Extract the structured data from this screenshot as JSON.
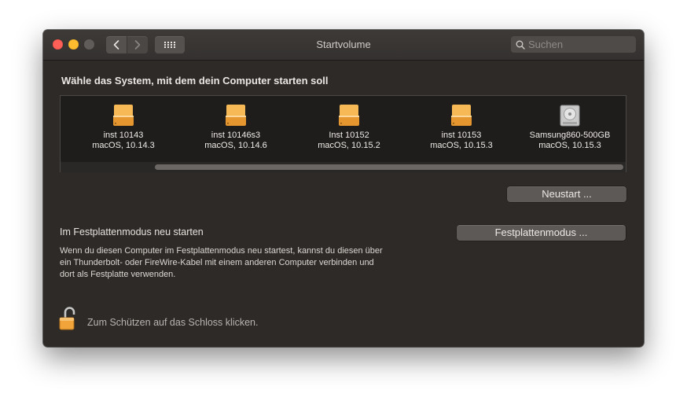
{
  "window": {
    "title": "Startvolume"
  },
  "search": {
    "placeholder": "Suchen"
  },
  "heading": "Wähle das System, mit dem dein Computer starten soll",
  "disks": [
    {
      "name": "inst 10143",
      "os": "macOS, 10.14.3",
      "icon": "external-orange-disk-icon"
    },
    {
      "name": "inst 10146s3",
      "os": "macOS, 10.14.6",
      "icon": "external-orange-disk-icon"
    },
    {
      "name": "Inst 10152",
      "os": "macOS, 10.15.2",
      "icon": "external-orange-disk-icon"
    },
    {
      "name": "inst 10153",
      "os": "macOS, 10.15.3",
      "icon": "external-orange-disk-icon"
    },
    {
      "name": "Samsung860-500GB",
      "os": "macOS, 10.15.3",
      "icon": "internal-hard-disk-icon"
    }
  ],
  "buttons": {
    "restart": "Neustart ...",
    "target_mode": "Festplattenmodus ..."
  },
  "target_mode": {
    "label": "Im Festplattenmodus neu starten",
    "description": "Wenn du diesen Computer im Festplattenmodus neu startest, kannst du diesen über ein Thunderbolt- oder FireWire-Kabel mit einem anderen Computer verbinden und dort als Festplatte verwenden."
  },
  "lock": {
    "text": "Zum Schützen auf das Schloss klicken."
  },
  "colors": {
    "window_bg": "#2d2a27",
    "disk_orange": "#f0a43a",
    "close": "#fe5f57",
    "minimize": "#febc2e"
  }
}
